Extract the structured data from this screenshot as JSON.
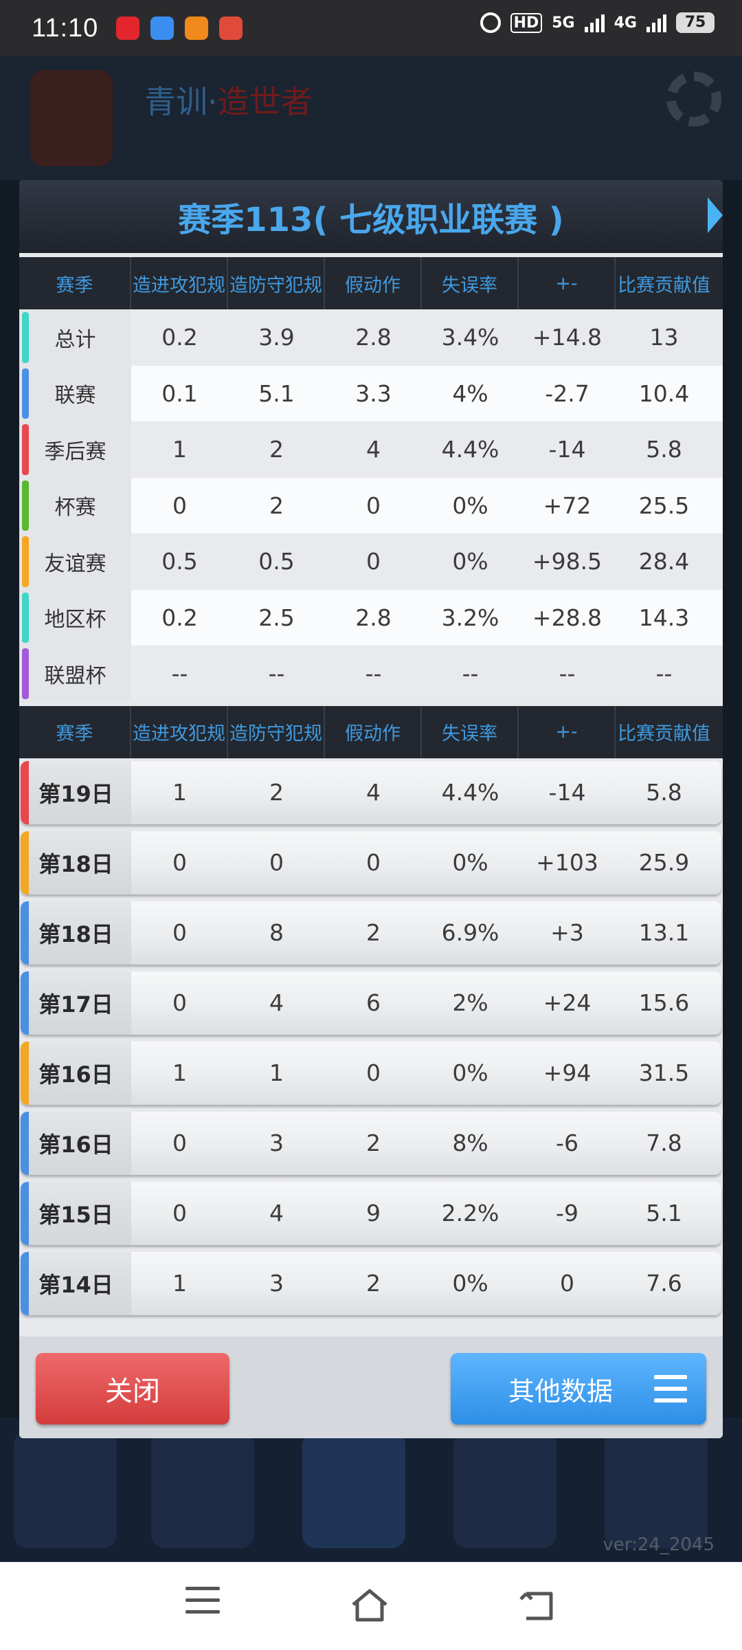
{
  "status_bar": {
    "time": "11:10",
    "battery": "75",
    "net1": "HD",
    "net2": "5G",
    "net3": "4G",
    "notification_icons": [
      "netease-music-icon",
      "browser-icon",
      "weibo-icon",
      "news-icon"
    ]
  },
  "background": {
    "title_part1": "青训",
    "title_sep": "·",
    "title_part2": "造世者",
    "version": "ver:24_2045"
  },
  "dialog": {
    "title": "赛季113( 七级职业联赛 )",
    "headers": [
      "赛季",
      "造进攻犯规",
      "造防守犯规",
      "假动作",
      "失误率",
      "+-",
      "比赛贡献值"
    ],
    "summary_rows": [
      {
        "label": "总计",
        "color": "#3fd6c6",
        "values": [
          "0.2",
          "3.9",
          "2.8",
          "3.4%",
          "+14.8",
          "13"
        ]
      },
      {
        "label": "联赛",
        "color": "#4a90e2",
        "values": [
          "0.1",
          "5.1",
          "3.3",
          "4%",
          "-2.7",
          "10.4"
        ]
      },
      {
        "label": "季后赛",
        "color": "#e8484e",
        "values": [
          "1",
          "2",
          "4",
          "4.4%",
          "-14",
          "5.8"
        ]
      },
      {
        "label": "杯赛",
        "color": "#58b82e",
        "values": [
          "0",
          "2",
          "0",
          "0%",
          "+72",
          "25.5"
        ]
      },
      {
        "label": "友谊赛",
        "color": "#f5a623",
        "values": [
          "0.5",
          "0.5",
          "0",
          "0%",
          "+98.5",
          "28.4"
        ]
      },
      {
        "label": "地区杯",
        "color": "#3fd6c6",
        "values": [
          "0.2",
          "2.5",
          "2.8",
          "3.2%",
          "+28.8",
          "14.3"
        ]
      },
      {
        "label": "联盟杯",
        "color": "#a25ad8",
        "values": [
          "--",
          "--",
          "--",
          "--",
          "--",
          "--"
        ]
      }
    ],
    "game_rows": [
      {
        "day": "第19日",
        "color": "#e8484e",
        "values": [
          "1",
          "2",
          "4",
          "4.4%",
          "-14",
          "5.8"
        ]
      },
      {
        "day": "第18日",
        "color": "#f5a623",
        "values": [
          "0",
          "0",
          "0",
          "0%",
          "+103",
          "25.9"
        ]
      },
      {
        "day": "第18日",
        "color": "#4a90e2",
        "values": [
          "0",
          "8",
          "2",
          "6.9%",
          "+3",
          "13.1"
        ]
      },
      {
        "day": "第17日",
        "color": "#4a90e2",
        "values": [
          "0",
          "4",
          "6",
          "2%",
          "+24",
          "15.6"
        ]
      },
      {
        "day": "第16日",
        "color": "#f5a623",
        "values": [
          "1",
          "1",
          "0",
          "0%",
          "+94",
          "31.5"
        ]
      },
      {
        "day": "第16日",
        "color": "#4a90e2",
        "values": [
          "0",
          "3",
          "2",
          "8%",
          "-6",
          "7.8"
        ]
      },
      {
        "day": "第15日",
        "color": "#4a90e2",
        "values": [
          "0",
          "4",
          "9",
          "2.2%",
          "-9",
          "5.1"
        ]
      },
      {
        "day": "第14日",
        "color": "#4a90e2",
        "values": [
          "1",
          "3",
          "2",
          "0%",
          "0",
          "7.6"
        ]
      }
    ],
    "close_label": "关闭",
    "other_label": "其他数据"
  }
}
